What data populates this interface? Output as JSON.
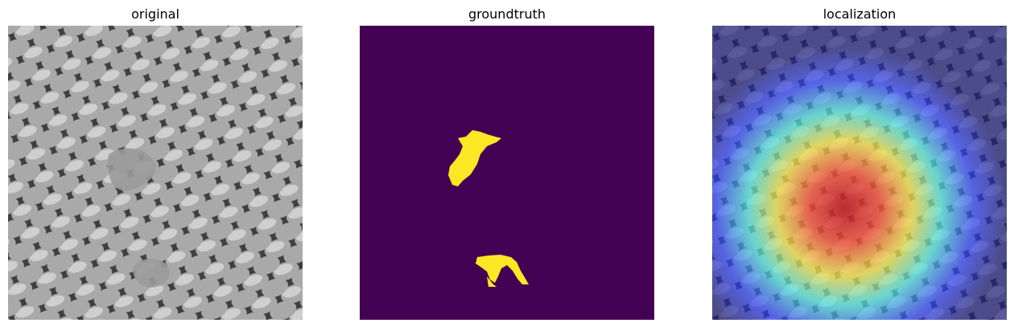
{
  "panels": [
    {
      "title": "original"
    },
    {
      "title": "groundtruth"
    },
    {
      "title": "localization"
    }
  ],
  "colors": {
    "mask_background": "#440154",
    "mask_foreground": "#fde725",
    "page_background": "#ffffff"
  }
}
